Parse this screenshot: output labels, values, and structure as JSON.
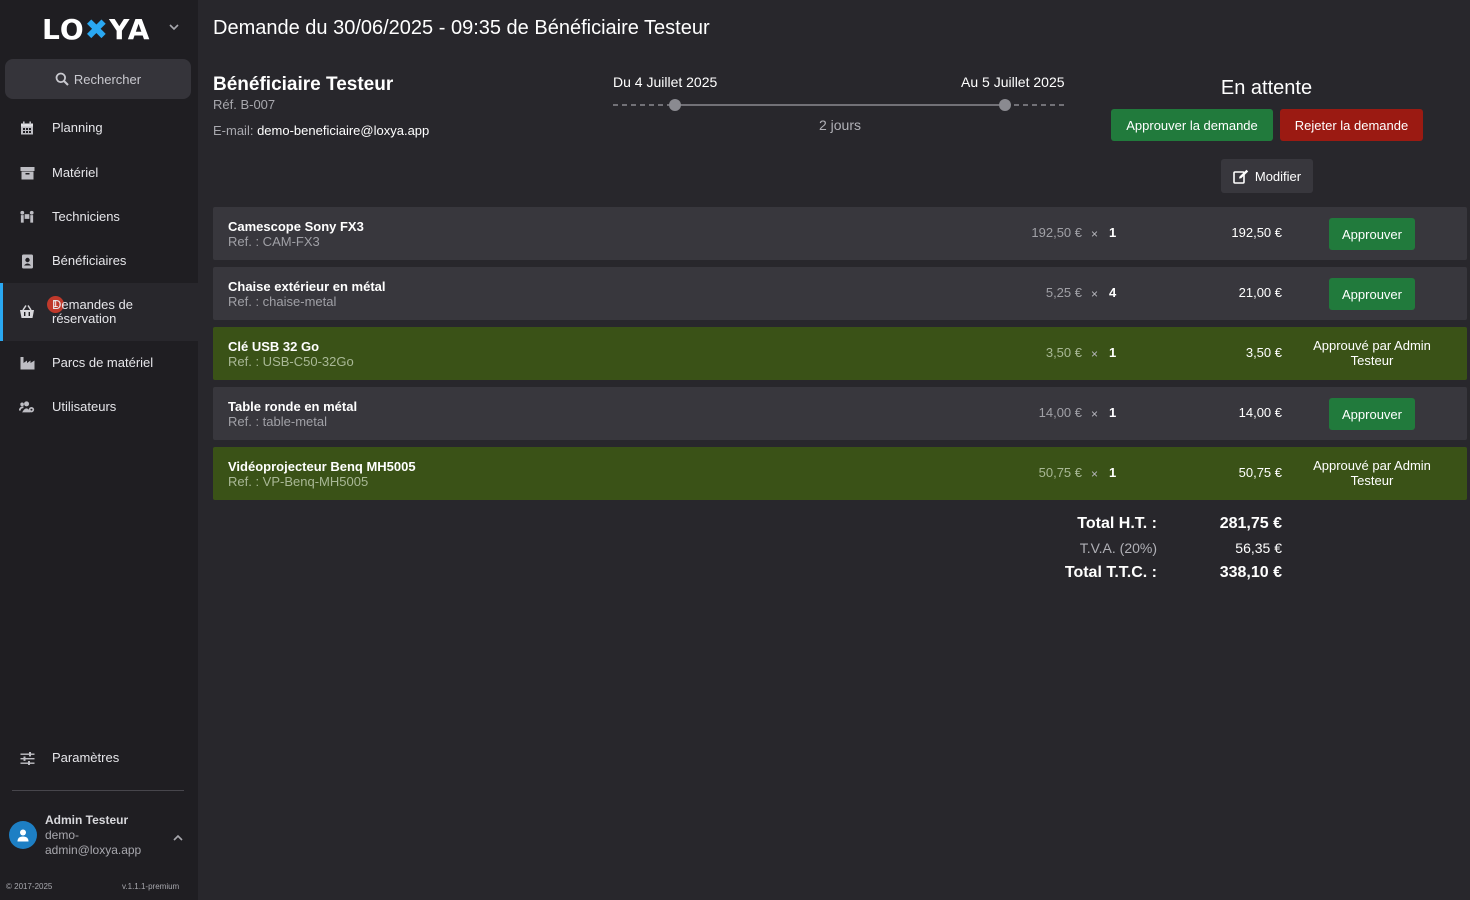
{
  "sidebar": {
    "logo": "LOXYA",
    "search_label": "Rechercher",
    "items": [
      {
        "label": "Planning",
        "icon": "calendar-icon"
      },
      {
        "label": "Matériel",
        "icon": "box-icon"
      },
      {
        "label": "Techniciens",
        "icon": "people-carry-icon"
      },
      {
        "label": "Bénéficiaires",
        "icon": "address-book-icon"
      },
      {
        "label": "Demandes de réservation",
        "icon": "basket-icon",
        "badge": "1"
      },
      {
        "label": "Parcs de matériel",
        "icon": "industry-icon"
      },
      {
        "label": "Utilisateurs",
        "icon": "users-cog-icon"
      }
    ],
    "settings_label": "Paramètres",
    "user": {
      "name": "Admin Testeur",
      "email": "demo-admin@loxya.app"
    },
    "footer": {
      "copyright": "© 2017-2025",
      "version": "v.1.1.1-premium"
    }
  },
  "header": {
    "title": "Demande du 30/06/2025 - 09:35 de Bénéficiaire Testeur"
  },
  "request": {
    "beneficiary_name": "Bénéficiaire Testeur",
    "reference": "Réf. B-007",
    "email_label": "E-mail:",
    "email": "demo-beneficiaire@loxya.app",
    "date_from": "Du 4 Juillet 2025",
    "date_to": "Au 5 Juillet 2025",
    "duration": "2 jours",
    "status": "En attente",
    "approve_all_label": "Approuver la demande",
    "reject_all_label": "Rejeter la demande",
    "modify_label": "Modifier"
  },
  "items": [
    {
      "name": "Camescope Sony FX3",
      "ref": "Ref. : CAM-FX3",
      "unit_price": "192,50 €",
      "times": "×",
      "quantity": "1",
      "total": "192,50 €",
      "approved": false,
      "action_label": "Approuver"
    },
    {
      "name": "Chaise extérieur en métal",
      "ref": "Ref. : chaise-metal",
      "unit_price": "5,25 €",
      "times": "×",
      "quantity": "4",
      "total": "21,00 €",
      "approved": false,
      "action_label": "Approuver"
    },
    {
      "name": "Clé USB 32 Go",
      "ref": "Ref. : USB-C50-32Go",
      "unit_price": "3,50 €",
      "times": "×",
      "quantity": "1",
      "total": "3,50 €",
      "approved": true,
      "action_label": "Approuvé par Admin Testeur"
    },
    {
      "name": "Table ronde en métal",
      "ref": "Ref. : table-metal",
      "unit_price": "14,00 €",
      "times": "×",
      "quantity": "1",
      "total": "14,00 €",
      "approved": false,
      "action_label": "Approuver"
    },
    {
      "name": "Vidéoprojecteur Benq MH5005",
      "ref": "Ref. : VP-Benq-MH5005",
      "unit_price": "50,75 €",
      "times": "×",
      "quantity": "1",
      "total": "50,75 €",
      "approved": true,
      "action_label": "Approuvé par Admin Testeur"
    }
  ],
  "totals": {
    "ht_label": "Total H.T. :",
    "ht_value": "281,75 €",
    "vat_label": "T.V.A. (20%)",
    "vat_value": "56,35 €",
    "ttc_label": "Total T.T.C. :",
    "ttc_value": "338,10 €"
  },
  "colors": {
    "accent": "#2aa8f2",
    "approve": "#217a3c",
    "reject": "#9b1a12",
    "approved_row": "#3a5217"
  }
}
